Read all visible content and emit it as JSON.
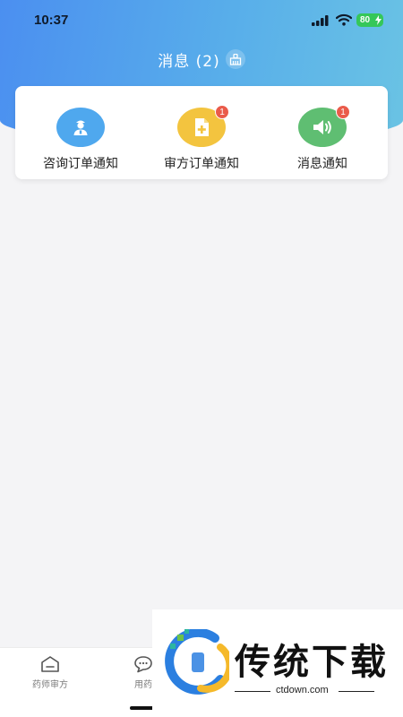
{
  "status_bar": {
    "time": "10:37",
    "battery": "80"
  },
  "header": {
    "title": "消息 (2)",
    "clear_icon": "broom-icon"
  },
  "categories": [
    {
      "label": "咨询订单通知",
      "icon": "doctor-icon",
      "color": "#4fa8ee",
      "badge": ""
    },
    {
      "label": "审方订单通知",
      "icon": "add-file-icon",
      "color": "#f3c43f",
      "badge": "1"
    },
    {
      "label": "消息通知",
      "icon": "speaker-icon",
      "color": "#5fbe72",
      "badge": "1"
    }
  ],
  "tab_bar": {
    "items": [
      {
        "label": "药师审方",
        "icon": "review-icon"
      },
      {
        "label": "用药",
        "icon": "chat-icon"
      }
    ]
  },
  "watermark": {
    "title": "传统下载",
    "url": "ctdown.com"
  },
  "colors": {
    "header_start": "#4b8ff0",
    "header_end": "#6ac3e4",
    "badge": "#ea5b4a",
    "battery": "#35c759"
  }
}
